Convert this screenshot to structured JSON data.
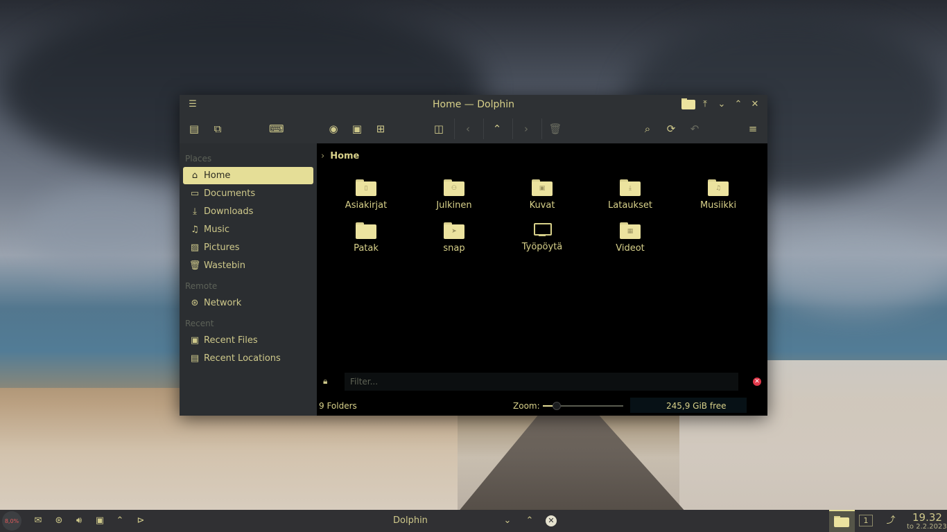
{
  "window": {
    "title": "Home — Dolphin"
  },
  "sidebar": {
    "sections": [
      {
        "title": "Places",
        "items": [
          {
            "label": "Home",
            "icon": "home-icon",
            "active": true
          },
          {
            "label": "Documents",
            "icon": "documents-icon"
          },
          {
            "label": "Downloads",
            "icon": "downloads-icon"
          },
          {
            "label": "Music",
            "icon": "music-icon"
          },
          {
            "label": "Pictures",
            "icon": "pictures-icon"
          },
          {
            "label": "Wastebin",
            "icon": "trash-icon"
          }
        ]
      },
      {
        "title": "Remote",
        "items": [
          {
            "label": "Network",
            "icon": "network-icon"
          }
        ]
      },
      {
        "title": "Recent",
        "items": [
          {
            "label": "Recent Files",
            "icon": "recent-files-icon"
          },
          {
            "label": "Recent Locations",
            "icon": "recent-locations-icon"
          }
        ]
      }
    ]
  },
  "breadcrumb": {
    "current": "Home"
  },
  "files": [
    {
      "name": "Asiakirjat",
      "icon": "folder-documents-icon"
    },
    {
      "name": "Julkinen",
      "icon": "folder-public-icon"
    },
    {
      "name": "Kuvat",
      "icon": "folder-pictures-icon"
    },
    {
      "name": "Lataukset",
      "icon": "folder-downloads-icon"
    },
    {
      "name": "Musiikki",
      "icon": "folder-music-icon"
    },
    {
      "name": "Patak",
      "icon": "folder-icon"
    },
    {
      "name": "snap",
      "icon": "folder-snap-icon"
    },
    {
      "name": "Työpöytä",
      "icon": "desktop-icon"
    },
    {
      "name": "Videot",
      "icon": "folder-videos-icon"
    }
  ],
  "filter": {
    "placeholder": "Filter..."
  },
  "status": {
    "count": "9 Folders",
    "zoom_label": "Zoom:",
    "zoom_level": 0.05,
    "free_space": "245,9 GiB free"
  },
  "taskbar": {
    "cpu": "8,0%",
    "task_label": "Dolphin",
    "desktop_number": "1",
    "time": "19.32",
    "date": "to 2.2.2023"
  },
  "colors": {
    "accent": "#e5de97",
    "text": "#d8d18a",
    "close_red": "#e0384a"
  }
}
